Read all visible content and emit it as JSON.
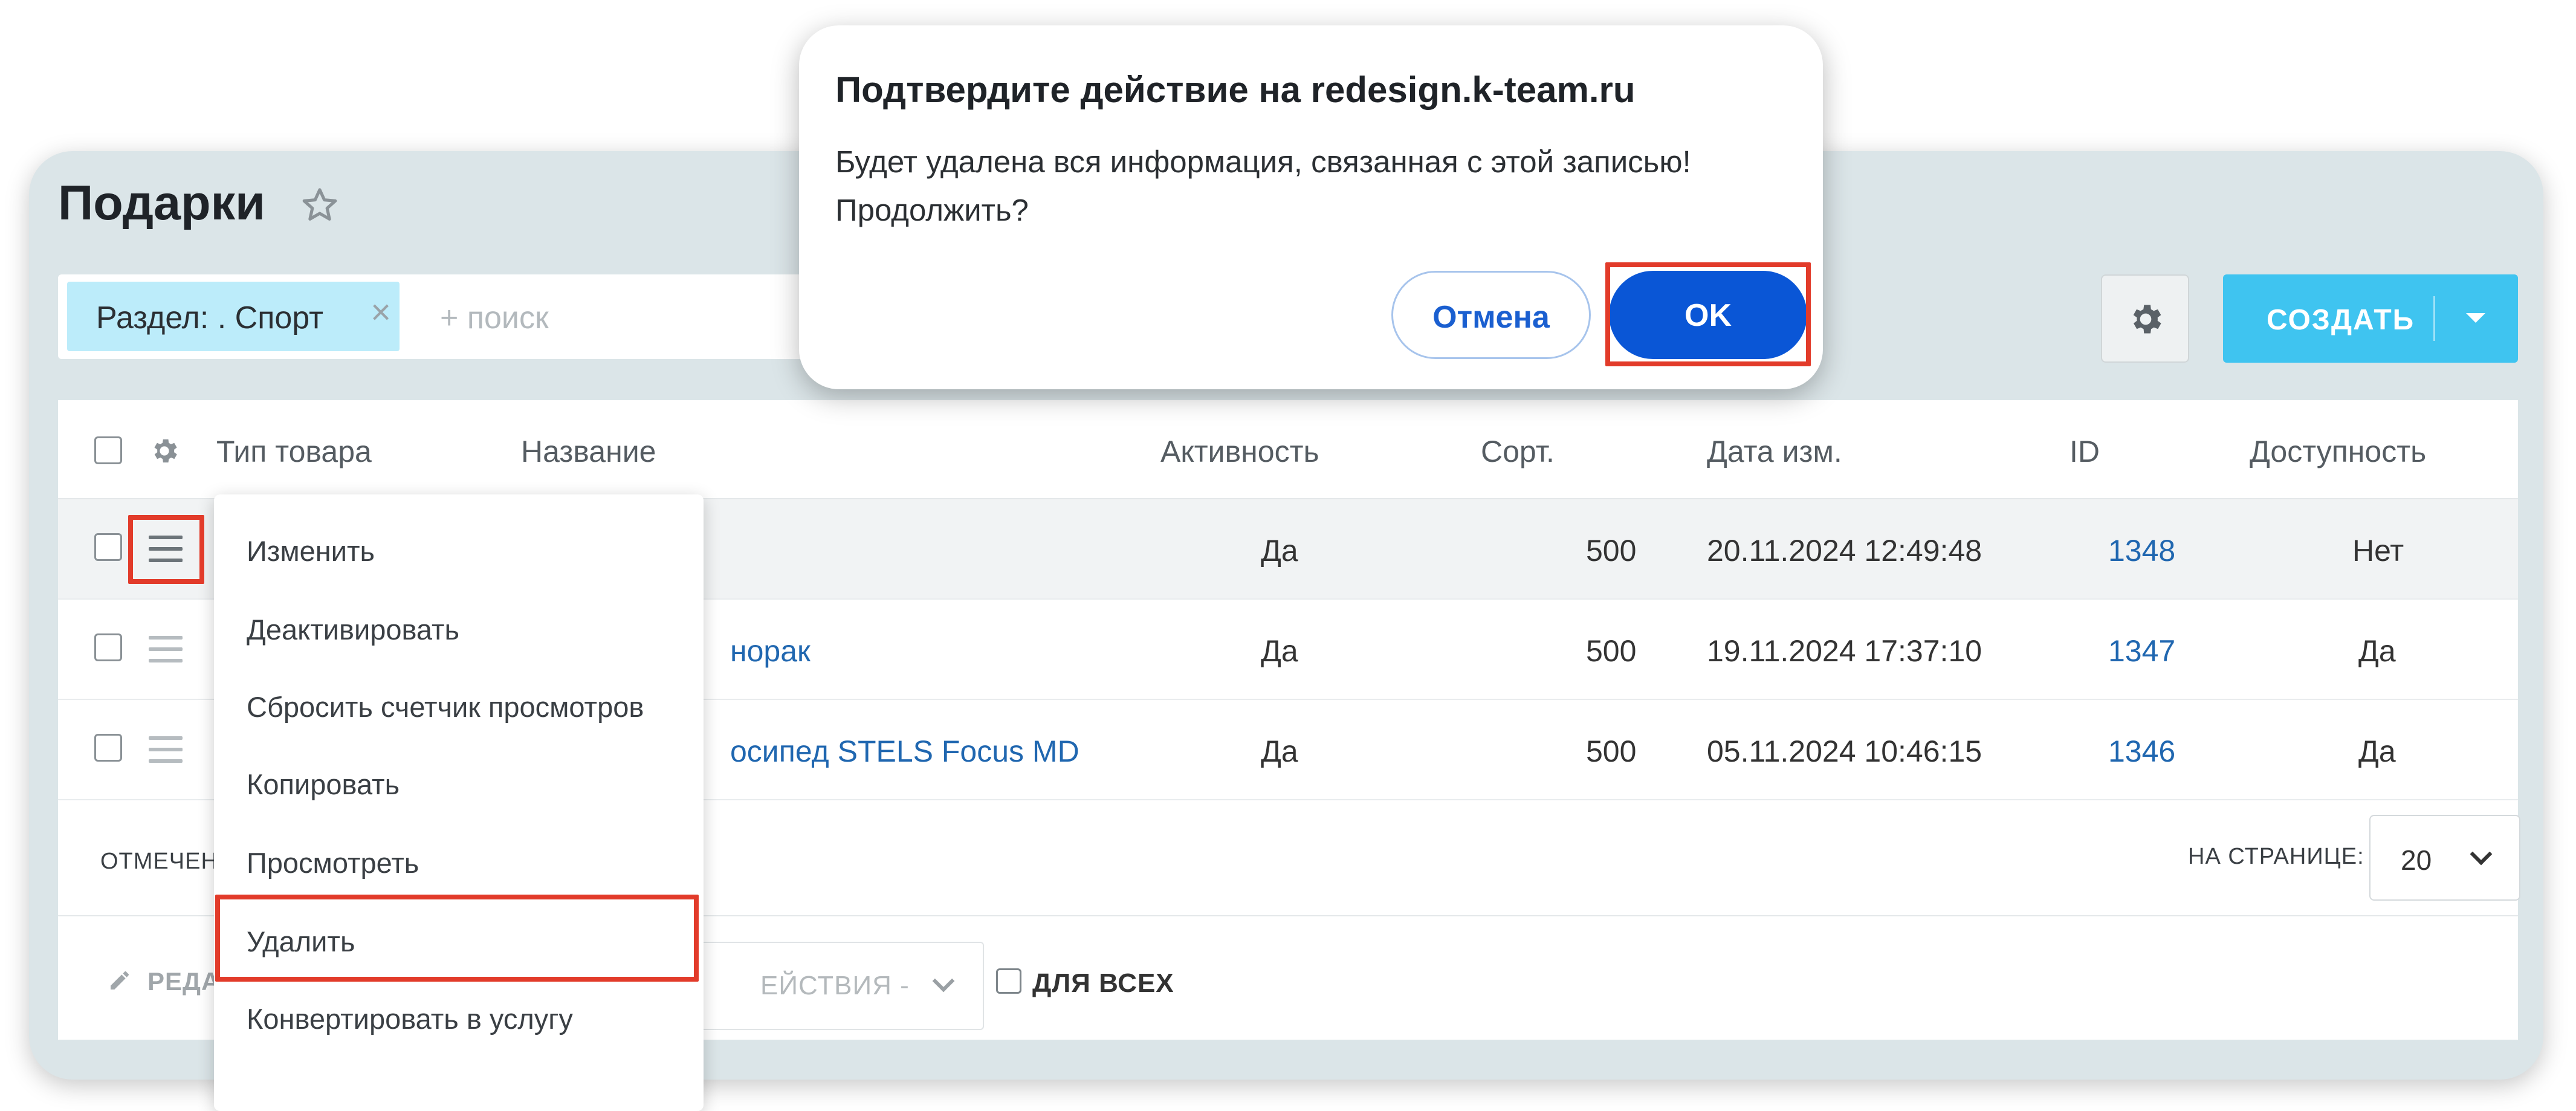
{
  "page": {
    "title": "Подарки"
  },
  "filter": {
    "chip_label": "Раздел: . Спорт",
    "search_placeholder": "+ поиск"
  },
  "toolbar": {
    "create_label": "СОЗДАТЬ"
  },
  "table": {
    "headers": [
      "Тип товара",
      "Название",
      "Активность",
      "Сорт.",
      "Дата изм.",
      "ID",
      "Доступность"
    ],
    "rows": [
      {
        "name": "",
        "active": "Да",
        "sort": "500",
        "date": "20.11.2024 12:49:48",
        "id": "1348",
        "available": "Нет"
      },
      {
        "name": "норак",
        "active": "Да",
        "sort": "500",
        "date": "19.11.2024 17:37:10",
        "id": "1347",
        "available": "Да"
      },
      {
        "name": "осипед STELS Focus MD",
        "active": "Да",
        "sort": "500",
        "date": "05.11.2024 10:46:15",
        "id": "1346",
        "available": "Да"
      }
    ]
  },
  "pager": {
    "marked_label": "ОТМЕЧЕН",
    "per_page_label": "НА СТРАНИЦЕ:",
    "per_page_value": "20"
  },
  "action_bar": {
    "edit_label": "РЕДА",
    "actions_label": "ЕЙСТВИЯ -",
    "for_all_label": "ДЛЯ ВСЕХ"
  },
  "context_menu": {
    "items": [
      "Изменить",
      "Деактивировать",
      "Сбросить счетчик просмотров",
      "Копировать",
      "Просмотреть",
      "Удалить",
      "Конвертировать в услугу"
    ]
  },
  "dialog": {
    "title": "Подтвердите действие на redesign.k-team.ru",
    "message_line1": "Будет удалена вся информация, связанная с этой записью!",
    "message_line2": "Продолжить?",
    "cancel_label": "Отмена",
    "ok_label": "OK"
  },
  "colors": {
    "accent": "#3fc4f0",
    "primary_button": "#0a56d6",
    "highlight": "#e23b2a",
    "link": "#2067b0"
  }
}
